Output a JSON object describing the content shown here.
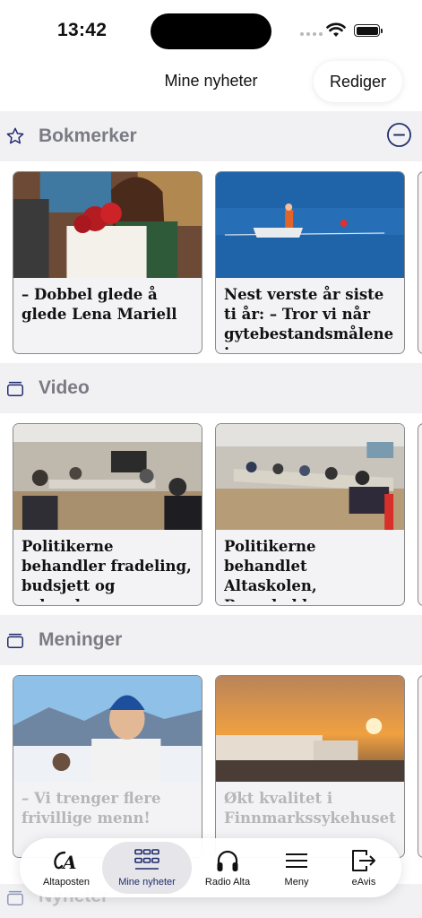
{
  "status_bar": {
    "time": "13:42"
  },
  "header": {
    "title": "Mine nyheter",
    "edit_label": "Rediger"
  },
  "sections": [
    {
      "title": "Bokmerker",
      "icon": "star-icon",
      "cards": [
        {
          "headline": "– Dobbel glede å glede Lena Mariell",
          "image": "woman-with-poinsettia-photo"
        },
        {
          "headline": "Nest verste år siste ti år: – Tror vi når gytebestandsmålene i",
          "image": "boat-on-sea-photo"
        }
      ]
    },
    {
      "title": "Video",
      "icon": "stack-icon",
      "cards": [
        {
          "headline": "Politikerne behandler fradeling, budsjett og søknader",
          "image": "council-meeting-photo"
        },
        {
          "headline": "Politikerne behandlet Altaskolen, Ressebakken og",
          "image": "council-meeting-photo-2"
        }
      ]
    },
    {
      "title": "Meninger",
      "icon": "stack-icon",
      "cards": [
        {
          "headline": "– Vi trenger flere frivillige menn!",
          "image": "man-in-winter-photo"
        },
        {
          "headline": "Økt kvalitet i Finnmarkssykehuset",
          "image": "hospital-sunset-photo"
        }
      ]
    }
  ],
  "partially_hidden_section": {
    "title": "Nyheter"
  },
  "tab_bar": {
    "items": [
      {
        "label": "Altaposten",
        "icon": "altaposten-logo-icon"
      },
      {
        "label": "Mine nyheter",
        "icon": "grid-icon",
        "active": true
      },
      {
        "label": "Radio Alta",
        "icon": "headphones-icon"
      },
      {
        "label": "Meny",
        "icon": "hamburger-menu-icon"
      },
      {
        "label": "eAvis",
        "icon": "exit-arrow-icon"
      }
    ],
    "logo_text": "A"
  },
  "colors": {
    "accent": "#1f2a6b",
    "section_bg": "#f1f1f4",
    "section_title": "#7b7b84"
  }
}
